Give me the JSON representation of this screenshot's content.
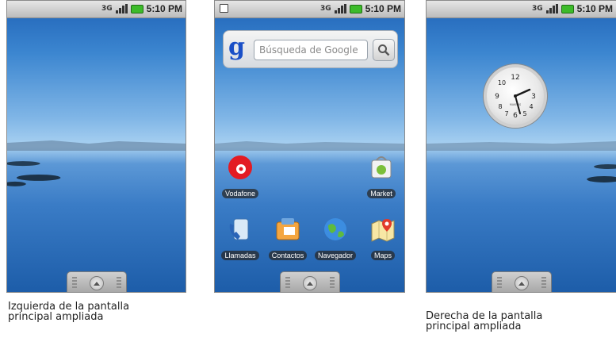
{
  "status_bar": {
    "network_label": "3G",
    "time": "5:10 PM",
    "icons": [
      "notification-icon",
      "signal-icon",
      "battery-icon"
    ]
  },
  "search_widget": {
    "logo": "g",
    "placeholder": "Búsqueda de Google",
    "button_icon": "magnifier-icon"
  },
  "apps": {
    "row1": [
      {
        "label": "Vodafone",
        "icon": "vodafone-icon"
      },
      {
        "label": "Market",
        "icon": "market-icon"
      }
    ],
    "row2": [
      {
        "label": "Llamadas",
        "icon": "phone-icon"
      },
      {
        "label": "Contactos",
        "icon": "contacts-icon"
      },
      {
        "label": "Navegador",
        "icon": "browser-icon"
      },
      {
        "label": "Maps",
        "icon": "maps-icon"
      }
    ]
  },
  "clock_widget": {
    "numerals": [
      "12",
      "3",
      "6",
      "9",
      "10",
      "8",
      "4",
      "5",
      "7"
    ],
    "brand": "MAKERS"
  },
  "captions": {
    "left": [
      "Izquierda de la pantalla",
      "principal ampliada"
    ],
    "right": [
      "Derecha de la pantalla",
      "principal ampliada"
    ]
  },
  "colors": {
    "battery": "#3cbb2a",
    "label_background": "#282828",
    "google_blue": "#1a4fc7"
  }
}
